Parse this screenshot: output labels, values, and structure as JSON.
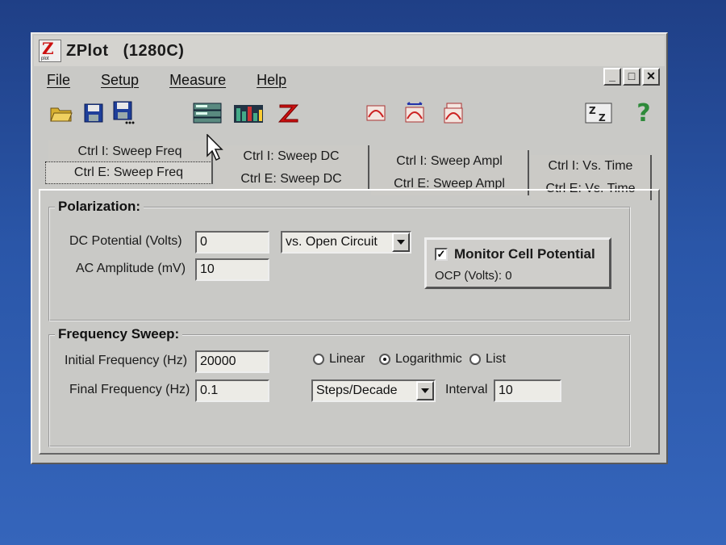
{
  "window": {
    "title": "ZPlot   (1280C)",
    "icon_label": "Z",
    "icon_sub": "plot",
    "controls": {
      "minimize": "_",
      "maximize": "□",
      "close": "✕"
    }
  },
  "menu": [
    "File",
    "Setup",
    "Measure",
    "Help"
  ],
  "toolbar": {
    "icons": [
      "open-folder-icon",
      "save-icon",
      "save-as-icon",
      "instrument-icon",
      "graph-icon",
      "z-icon",
      "sweep-icon-1",
      "sweep-icon-2",
      "sweep-icon-3",
      "zz-icon",
      "help-icon"
    ]
  },
  "tabs": {
    "row1": [
      "Ctrl I: Sweep Freq",
      "Ctrl I: Sweep DC",
      "Ctrl I: Sweep Ampl",
      "Ctrl I: Vs. Time"
    ],
    "row2": [
      "Ctrl E: Sweep Freq",
      "Ctrl E: Sweep DC",
      "Ctrl E: Sweep Ampl",
      "Ctrl E: Vs. Time"
    ],
    "selected": "Ctrl E: Sweep Freq"
  },
  "polarization": {
    "title": "Polarization:",
    "dc_label": "DC Potential (Volts)",
    "dc_value": "0",
    "ac_label": "AC Amplitude (mV)",
    "ac_value": "10",
    "reference": "vs. Open Circuit",
    "monitor_label": "Monitor Cell Potential",
    "monitor_checked": true,
    "ocp_text": "OCP (Volts): 0"
  },
  "frequency_sweep": {
    "title": "Frequency Sweep:",
    "initial_label": "Initial Frequency (Hz)",
    "initial_value": "20000",
    "final_label": "Final Frequency (Hz)",
    "final_value": "0.1",
    "modes": [
      "Linear",
      "Logarithmic",
      "List"
    ],
    "selected_mode": "Logarithmic",
    "steps_option": "Steps/Decade",
    "interval_label": "Interval",
    "interval_value": "10"
  },
  "colors": {
    "window_bg": "#c9c9c6",
    "desktop": "#2a56a8",
    "accent_red": "#c11"
  }
}
